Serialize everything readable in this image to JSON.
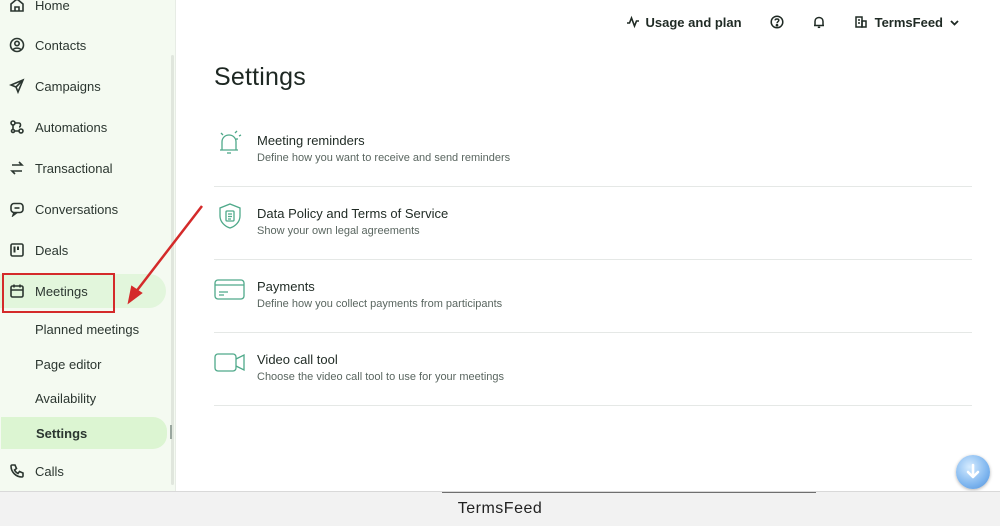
{
  "sidebar": {
    "items": [
      {
        "label": "Home",
        "icon": "home-icon"
      },
      {
        "label": "Contacts",
        "icon": "contacts-icon"
      },
      {
        "label": "Campaigns",
        "icon": "send-icon"
      },
      {
        "label": "Automations",
        "icon": "automation-icon"
      },
      {
        "label": "Transactional",
        "icon": "transfer-arrows-icon"
      },
      {
        "label": "Conversations",
        "icon": "chat-icon"
      },
      {
        "label": "Deals",
        "icon": "kanban-icon"
      },
      {
        "label": "Meetings",
        "icon": "calendar-icon"
      }
    ],
    "meetings_sub": [
      {
        "label": "Planned meetings"
      },
      {
        "label": "Page editor"
      },
      {
        "label": "Availability"
      },
      {
        "label": "Settings"
      }
    ],
    "after": {
      "label": "Calls",
      "icon": "phone-icon"
    }
  },
  "topbar": {
    "usage_label": "Usage and plan",
    "account_label": "TermsFeed"
  },
  "main": {
    "title": "Settings",
    "rows": [
      {
        "title": "Meeting reminders",
        "desc": "Define how you want to receive and send reminders",
        "icon": "bell-reminder-icon"
      },
      {
        "title": "Data Policy and Terms of Service",
        "desc": "Show your own legal agreements",
        "icon": "shield-document-icon"
      },
      {
        "title": "Payments",
        "desc": "Define how you collect payments from participants",
        "icon": "credit-card-icon"
      },
      {
        "title": "Video call tool",
        "desc": "Choose the video call tool to use for your meetings",
        "icon": "video-camera-icon"
      }
    ]
  },
  "footer": {
    "brand": "TermsFeed"
  },
  "colors": {
    "accent_green": "#4fa98a",
    "highlight_red": "#d42a2a",
    "active_bg": "#dcf5d2"
  }
}
